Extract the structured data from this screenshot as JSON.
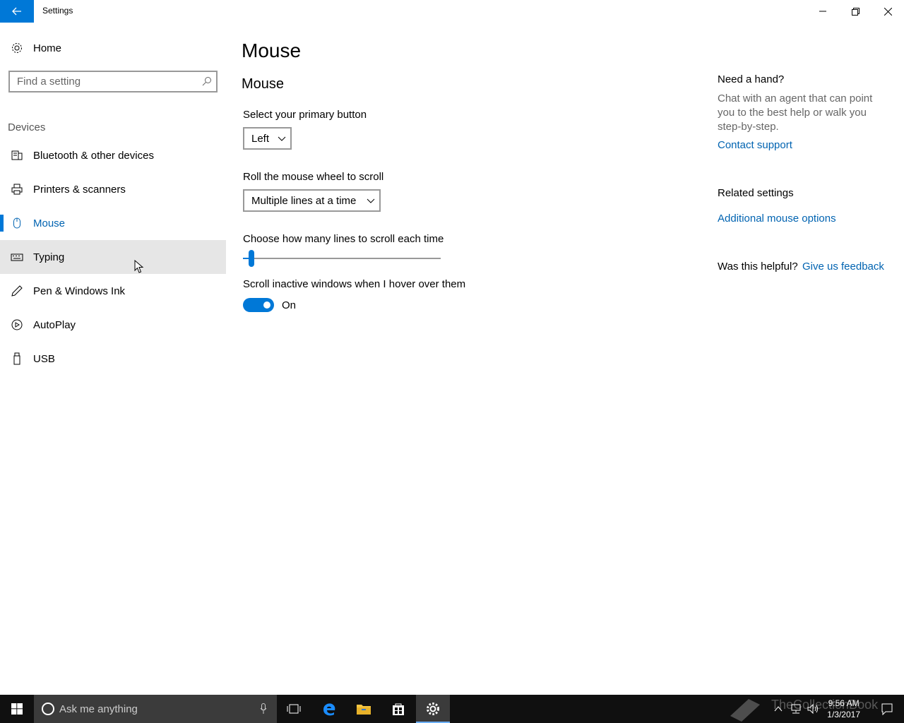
{
  "window": {
    "title": "Settings"
  },
  "sidebar": {
    "home_label": "Home",
    "search_placeholder": "Find a setting",
    "section_label": "Devices",
    "items": [
      {
        "label": "Bluetooth & other devices",
        "icon": "bluetooth-devices-icon"
      },
      {
        "label": "Printers & scanners",
        "icon": "printer-icon"
      },
      {
        "label": "Mouse",
        "icon": "mouse-icon",
        "selected": true
      },
      {
        "label": "Typing",
        "icon": "keyboard-icon",
        "hover": true
      },
      {
        "label": "Pen & Windows Ink",
        "icon": "pen-icon"
      },
      {
        "label": "AutoPlay",
        "icon": "autoplay-icon"
      },
      {
        "label": "USB",
        "icon": "usb-icon"
      }
    ]
  },
  "main": {
    "page_title": "Mouse",
    "section_title": "Mouse",
    "primary_button": {
      "label": "Select your primary button",
      "value": "Left"
    },
    "wheel_scroll": {
      "label": "Roll the mouse wheel to scroll",
      "value": "Multiple lines at a time"
    },
    "lines_slider": {
      "label": "Choose how many lines to scroll each time",
      "value_fraction": 0.03
    },
    "inactive_scroll": {
      "label": "Scroll inactive windows when I hover over them",
      "state": "On"
    }
  },
  "right_panel": {
    "help_heading": "Need a hand?",
    "help_text": "Chat with an agent that can point you to the best help or walk you step-by-step.",
    "contact_link": "Contact support",
    "related_heading": "Related settings",
    "mouse_options_link": "Additional mouse options",
    "helpful_label": "Was this helpful?",
    "feedback_link": "Give us feedback"
  },
  "taskbar": {
    "search_placeholder": "Ask me anything",
    "time": "9:56 AM",
    "date": "1/3/2017",
    "watermark": "TheCollectionBook"
  },
  "colors": {
    "accent": "#0078d7",
    "link": "#0063b1",
    "taskbar": "#101010"
  }
}
